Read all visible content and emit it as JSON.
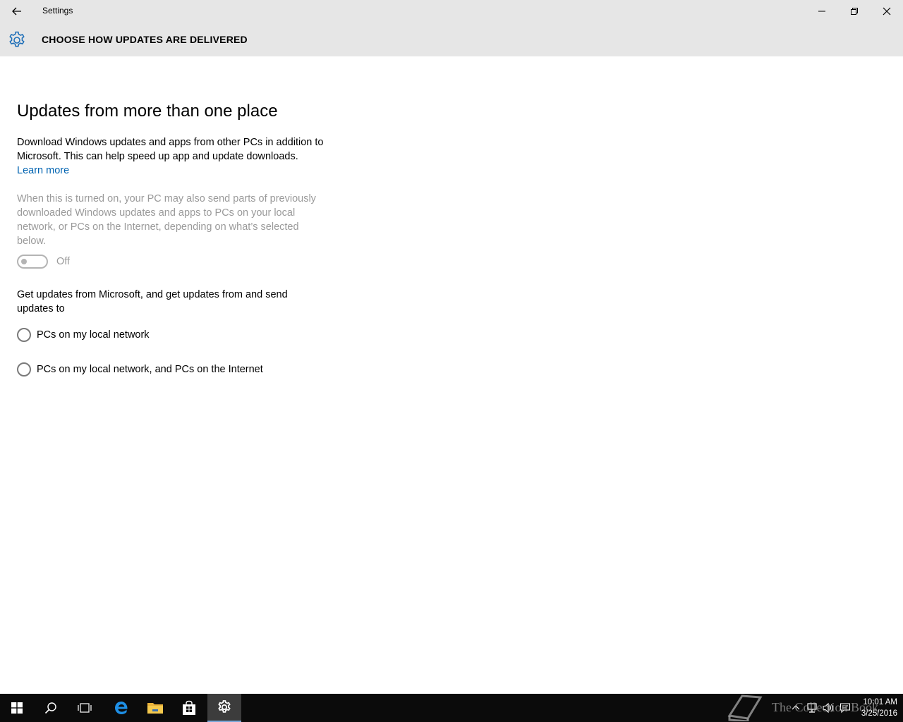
{
  "window": {
    "app_title": "Settings",
    "page_title": "CHOOSE HOW UPDATES ARE DELIVERED"
  },
  "content": {
    "section_title": "Updates from more than one place",
    "description": "Download Windows updates and apps from other PCs in addition to Microsoft. This can help speed up app and update downloads.",
    "learn_more": "Learn more",
    "note": "When this is turned on, your PC may also send parts of previously downloaded Windows updates and apps to PCs on your local network, or PCs on the Internet, depending on what’s selected below.",
    "toggle_label": "Off",
    "toggle_on": false,
    "group_label": "Get updates from Microsoft, and get updates from and send updates to",
    "options": [
      {
        "label": "PCs on my local network",
        "selected": false
      },
      {
        "label": "PCs on my local network, and PCs on the Internet",
        "selected": false
      }
    ]
  },
  "taskbar": {
    "time": "10:01 AM",
    "date": "3/25/2016",
    "active_app": "settings"
  },
  "watermark": {
    "text": "The Collection Book"
  },
  "colors": {
    "titlebar_bg": "#e6e6e6",
    "accent": "#0063b1",
    "disabled_text": "#9a9a9a",
    "taskbar_bg": "#0b0b0b"
  }
}
